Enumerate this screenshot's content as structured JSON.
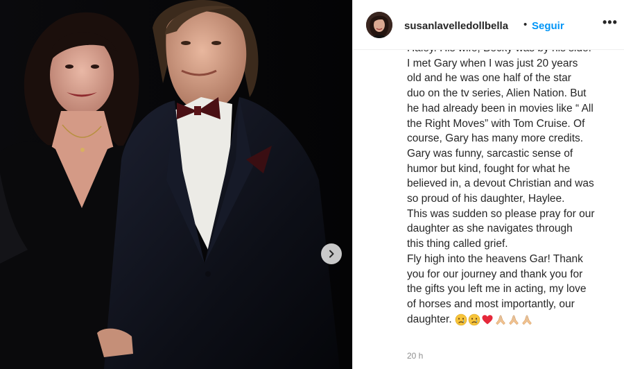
{
  "post": {
    "username": "susanlavelledollbella",
    "separator": "•",
    "follow_label": "Seguir",
    "more_label": "•••",
    "caption_lines": [
      "Haley. His wife, Becky was by his side.",
      "I met Gary when I was just 20 years",
      "old and he was one half of the star",
      "duo on the tv series, Alien Nation. But",
      "he had already been in movies like “ All",
      "the Right Moves” with Tom Cruise. Of",
      "course, Gary has many more credits.",
      "Gary was funny, sarcastic sense of",
      "humor but kind, fought for what he",
      "believed in, a devout Christian and was",
      "so proud of his daughter, Haylee.",
      "This was sudden so please pray for our",
      "daughter as she navigates through",
      "this thing called grief.",
      "Fly high into the heavens Gar! Thank",
      "you for our journey and thank you for",
      "the gifts you left me in acting, my love",
      "of horses and most importantly, our"
    ],
    "caption_last_line": "daughter.",
    "emojis": [
      "crying-face",
      "crying-face",
      "red-heart",
      "folded-hands",
      "folded-hands",
      "folded-hands"
    ],
    "timestamp": "20 h"
  },
  "colors": {
    "follow_blue": "#0095f6",
    "text": "#262626",
    "muted": "#8e8e8e",
    "divider": "#efefef"
  },
  "icons": {
    "next": "chevron-right-icon",
    "more": "more-options-icon"
  }
}
